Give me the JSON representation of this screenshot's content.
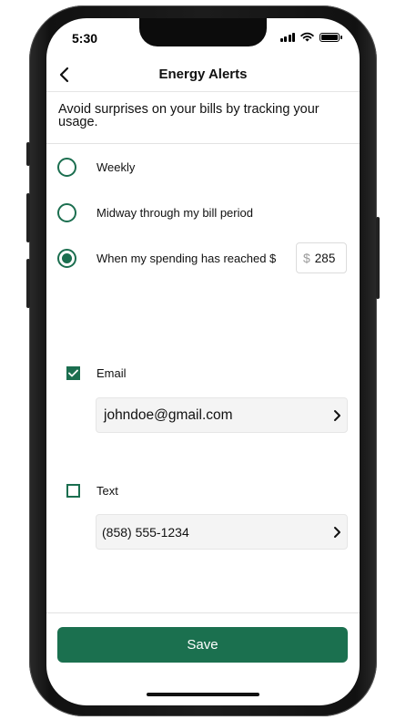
{
  "status_bar": {
    "time": "5:30"
  },
  "nav": {
    "title": "Energy Alerts",
    "back_icon": "chevron-left-icon"
  },
  "intro": {
    "text": "Avoid surprises on your bills by tracking your usage."
  },
  "frequency_options": [
    {
      "label": "Weekly",
      "selected": false
    },
    {
      "label": "Midway through my bill period",
      "selected": false
    },
    {
      "label": "When my spending has reached $",
      "selected": true
    }
  ],
  "spending_threshold": {
    "currency_symbol": "$",
    "value": "285"
  },
  "channels": {
    "email": {
      "label": "Email",
      "checked": true,
      "value": "johndoe@gmail.com"
    },
    "text": {
      "label": "Text",
      "checked": false,
      "value": "(858) 555-1234"
    }
  },
  "save_label": "Save",
  "colors": {
    "accent": "#1b704f",
    "text": "#111111",
    "field_bg": "#f4f4f4"
  }
}
